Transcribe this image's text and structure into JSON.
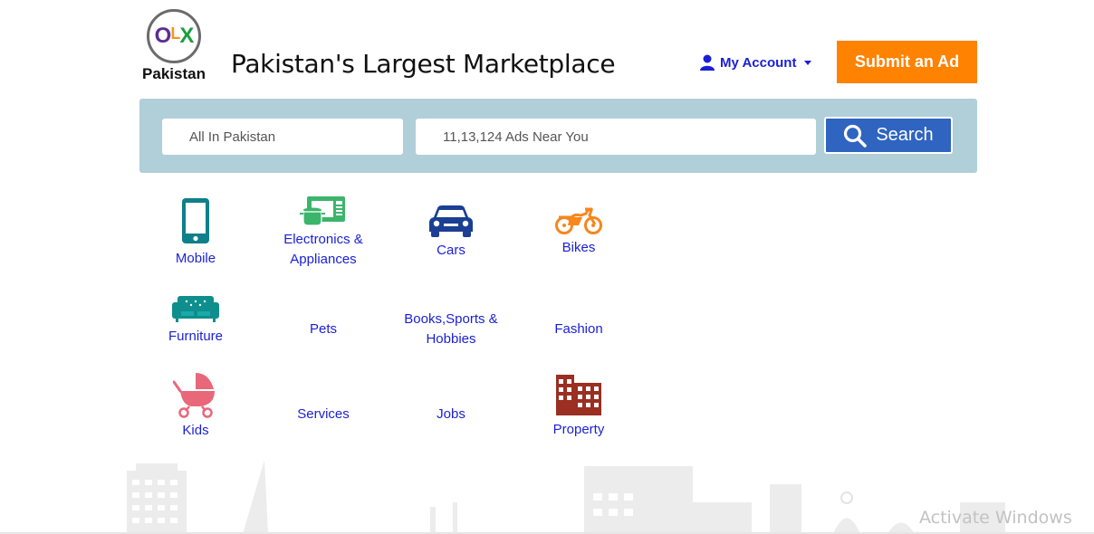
{
  "header": {
    "logo_text": "OLX",
    "logo_letters": [
      "O",
      "L",
      "X"
    ],
    "country": "Pakistan",
    "tagline": "Pakistan's Largest Marketplace",
    "account_label": "My Account",
    "submit_label": "Submit an Ad"
  },
  "search": {
    "location_placeholder": "All In Pakistan",
    "query_placeholder": "11,13,124 Ads Near You",
    "button_label": "Search"
  },
  "categories": [
    {
      "label": "Mobile",
      "icon": "mobile-phone-icon"
    },
    {
      "label": "Electronics &\nAppliances",
      "line1": "Electronics &",
      "line2": "Appliances",
      "icon": "microwave-pot-icon"
    },
    {
      "label": "Cars",
      "icon": "car-icon"
    },
    {
      "label": "Bikes",
      "icon": "motorbike-icon"
    },
    {
      "label": "Furniture",
      "icon": "sofa-icon"
    },
    {
      "label": "Pets"
    },
    {
      "label": "Books,Sports &\nHobbies",
      "line1": "Books,Sports &",
      "line2": "Hobbies"
    },
    {
      "label": "Fashion"
    },
    {
      "label": "Kids",
      "icon": "stroller-icon"
    },
    {
      "label": "Services"
    },
    {
      "label": "Jobs"
    },
    {
      "label": "Property",
      "icon": "buildings-icon"
    }
  ],
  "watermark": "Activate Windows",
  "colors": {
    "accent_orange": "#ff8200",
    "link_blue": "#1a1fd6",
    "search_bg": "#b0cfd9",
    "search_button": "#2f64c0"
  }
}
